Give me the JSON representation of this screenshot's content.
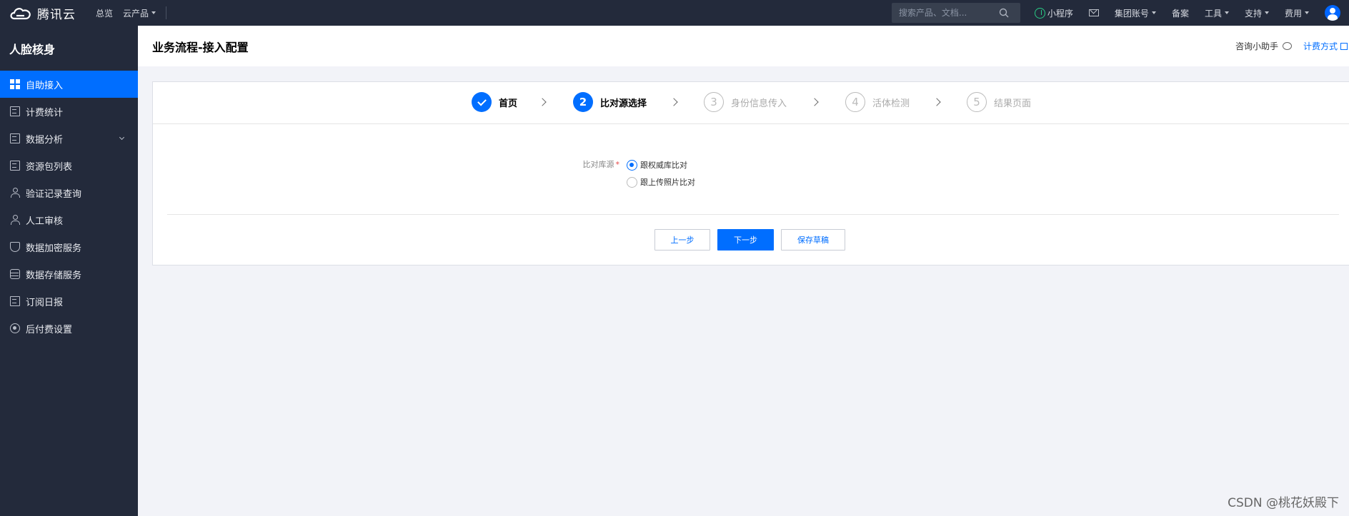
{
  "topbar": {
    "brand": "腾讯云",
    "nav": [
      {
        "label": "总览",
        "has_caret": false
      },
      {
        "label": "云产品",
        "has_caret": true
      }
    ],
    "search_placeholder": "搜索产品、文档...",
    "right_items": {
      "miniprogram": "小程序",
      "group_account": "集团账号",
      "filing": "备案",
      "tools": "工具",
      "support": "支持",
      "billing": "费用"
    }
  },
  "sidebar": {
    "title": "人脸核身",
    "items": [
      {
        "label": "自助接入",
        "active": true,
        "icon": "grid-icon"
      },
      {
        "label": "计费统计",
        "icon": "document-icon"
      },
      {
        "label": "数据分析",
        "icon": "chart-document-icon",
        "expandable": true
      },
      {
        "label": "资源包列表",
        "icon": "package-list-icon"
      },
      {
        "label": "验证记录查询",
        "icon": "user-search-icon"
      },
      {
        "label": "人工审核",
        "icon": "user-review-icon"
      },
      {
        "label": "数据加密服务",
        "icon": "shield-icon"
      },
      {
        "label": "数据存储服务",
        "icon": "database-icon"
      },
      {
        "label": "订阅日报",
        "icon": "report-icon"
      },
      {
        "label": "后付费设置",
        "icon": "settings-circle-icon"
      }
    ]
  },
  "header": {
    "title": "业务流程-接入配置",
    "helper": "咨询小助手",
    "pricing_link": "计费方式"
  },
  "steps": [
    {
      "number": "1",
      "label": "首页",
      "state": "done"
    },
    {
      "number": "2",
      "label": "比对源选择",
      "state": "current"
    },
    {
      "number": "3",
      "label": "身份信息传入",
      "state": "pending"
    },
    {
      "number": "4",
      "label": "活体检测",
      "state": "pending"
    },
    {
      "number": "5",
      "label": "结果页面",
      "state": "pending"
    }
  ],
  "form": {
    "label": "比对库源",
    "required_mark": "*",
    "options": [
      {
        "label": "跟权威库比对",
        "checked": true
      },
      {
        "label": "跟上传照片比对",
        "checked": false
      }
    ]
  },
  "buttons": {
    "prev": "上一步",
    "next": "下一步",
    "save_draft": "保存草稿"
  },
  "watermark": "CSDN @桃花妖殿下",
  "colors": {
    "accent": "#006eff",
    "dark_bg": "#232a3b",
    "page_bg": "#f2f3f8"
  }
}
